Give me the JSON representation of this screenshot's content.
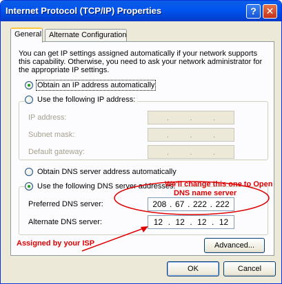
{
  "window": {
    "title": "Internet Protocol (TCP/IP) Properties"
  },
  "title_buttons": {
    "help": "?",
    "close": "✕"
  },
  "tabs": [
    {
      "label": "General",
      "active": true
    },
    {
      "label": "Alternate Configuration",
      "active": false
    }
  ],
  "intro_text": "You can get IP settings assigned automatically if your network supports this capability. Otherwise, you need to ask your network administrator for the appropriate IP settings.",
  "ip": {
    "auto_label": "Obtain an IP address automatically",
    "manual_label": "Use the following IP address:",
    "fields": [
      {
        "label": "IP address:"
      },
      {
        "label": "Subnet mask:"
      },
      {
        "label": "Default gateway:"
      }
    ],
    "dot": "."
  },
  "dns": {
    "auto_label": "Obtain DNS server address automatically",
    "manual_label": "Use the following DNS server addresses:",
    "preferred_label": "Preferred DNS server:",
    "preferred_octets": [
      "208",
      "67",
      "222",
      "222"
    ],
    "alternate_label": "Alternate DNS server:",
    "alternate_octets": [
      "12",
      "12",
      "12",
      "12"
    ]
  },
  "buttons": {
    "advanced": "Advanced...",
    "ok": "OK",
    "cancel": "Cancel"
  },
  "annotations": {
    "opendns_line1": "We'll change this one to Open",
    "opendns_line2": "DNS name server",
    "isp": "Assigned by your ISP",
    "color": "#e00000"
  },
  "selected": {
    "ip": "auto",
    "dns": "manual"
  }
}
